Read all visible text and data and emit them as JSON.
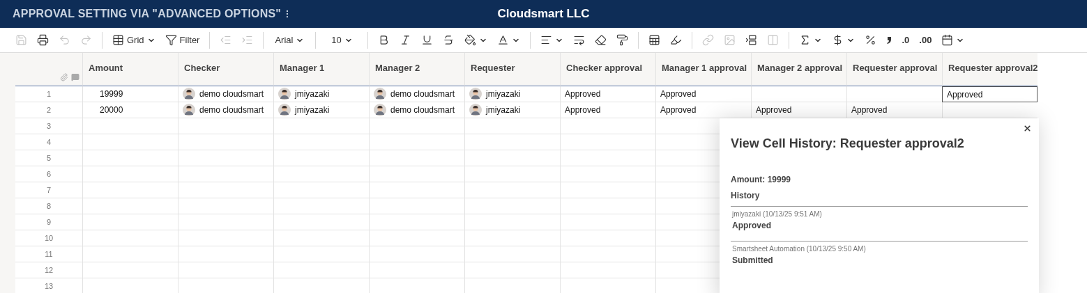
{
  "header": {
    "sheet_title": "APPROVAL SETTING VIA \"ADVANCED OPTIONS\"",
    "workspace": "Cloudsmart LLC"
  },
  "toolbar": {
    "groups": [
      {
        "items": [
          {
            "disabled": true
          },
          {
            "disabled": false
          },
          {
            "disabled": true
          },
          {
            "disabled": true
          }
        ]
      },
      {
        "items": [
          {
            "disabled": false,
            "label": "Grid",
            "caret": true
          },
          {
            "disabled": false,
            "label": "Filter"
          }
        ]
      },
      {
        "items": [
          {
            "disabled": true
          },
          {
            "disabled": true
          }
        ]
      },
      {
        "items": [
          {
            "disabled": false,
            "label": "Arial",
            "caret": true,
            "kind": "select"
          }
        ]
      },
      {
        "items": [
          {
            "disabled": false,
            "label": "10",
            "caret": true,
            "kind": "select"
          }
        ]
      },
      {
        "items": [
          {
            "disabled": false
          },
          {
            "disabled": false
          },
          {
            "disabled": false
          },
          {
            "disabled": false
          },
          {
            "disabled": false,
            "caret": true
          },
          {
            "disabled": false,
            "caret": true
          }
        ]
      },
      {
        "items": [
          {
            "disabled": false,
            "caret": true
          },
          {
            "disabled": false
          },
          {
            "disabled": false
          },
          {
            "disabled": false
          }
        ]
      },
      {
        "items": [
          {
            "disabled": false
          },
          {
            "disabled": false
          }
        ]
      },
      {
        "items": [
          {
            "disabled": true
          },
          {
            "disabled": true
          },
          {
            "disabled": false
          },
          {
            "disabled": true
          }
        ]
      },
      {
        "items": [
          {
            "disabled": false,
            "caret": true
          },
          {
            "disabled": false,
            "caret": true
          },
          {
            "disabled": false
          },
          {
            "disabled": false
          },
          {
            "disabled": false,
            "label": ".0",
            "kind": "text"
          },
          {
            "disabled": false,
            "label": ".00",
            "kind": "text"
          },
          {
            "disabled": false,
            "caret": true
          }
        ]
      }
    ]
  },
  "table": {
    "columns": [
      "Amount",
      "Checker",
      "Manager 1",
      "Manager 2",
      "Requester",
      "Checker approval",
      "Manager 1 approval",
      "Manager 2 approval",
      "Requester approval",
      "Requester approval2"
    ],
    "rows": [
      {
        "number": "1",
        "cells": [
          {
            "text": "19999",
            "kind": "number",
            "selected": false
          },
          {
            "text": "demo cloudsmart",
            "kind": "contact",
            "selected": false
          },
          {
            "text": "jmiyazaki",
            "kind": "contact",
            "selected": false
          },
          {
            "text": "demo cloudsmart",
            "kind": "contact",
            "selected": false
          },
          {
            "text": "jmiyazaki",
            "kind": "contact",
            "selected": false
          },
          {
            "text": "Approved",
            "kind": "text",
            "selected": false
          },
          {
            "text": "Approved",
            "kind": "text",
            "selected": false
          },
          {
            "kind": "text",
            "selected": false
          },
          {
            "kind": "text",
            "selected": false
          },
          {
            "text": "Approved",
            "kind": "text",
            "selected": true
          }
        ]
      },
      {
        "number": "2",
        "cells": [
          {
            "text": "20000",
            "kind": "number",
            "selected": false
          },
          {
            "text": "demo cloudsmart",
            "kind": "contact",
            "selected": false
          },
          {
            "text": "jmiyazaki",
            "kind": "contact",
            "selected": false
          },
          {
            "text": "demo cloudsmart",
            "kind": "contact",
            "selected": false
          },
          {
            "text": "jmiyazaki",
            "kind": "contact",
            "selected": false
          },
          {
            "text": "Approved",
            "kind": "text",
            "selected": false
          },
          {
            "text": "Approved",
            "kind": "text",
            "selected": false
          },
          {
            "text": "Approved",
            "kind": "text",
            "selected": false
          },
          {
            "text": "Approved",
            "kind": "text",
            "selected": false
          },
          {
            "kind": "text",
            "selected": false
          }
        ]
      },
      {
        "number": "3"
      },
      {
        "number": "4"
      },
      {
        "number": "5"
      },
      {
        "number": "6"
      },
      {
        "number": "7"
      },
      {
        "number": "8"
      },
      {
        "number": "9"
      },
      {
        "number": "10"
      },
      {
        "number": "11"
      },
      {
        "number": "12"
      },
      {
        "number": "13"
      }
    ]
  },
  "history_panel": {
    "title": "View Cell History: Requester approval2",
    "row_label": "Amount: 19999",
    "section": "History",
    "entries": [
      {
        "meta": "jmiyazaki (10/13/25 9:51 AM)",
        "value": "Approved"
      },
      {
        "meta": "Smartsheet Automation (10/13/25 9:50 AM)",
        "value": "Submitted"
      }
    ]
  }
}
